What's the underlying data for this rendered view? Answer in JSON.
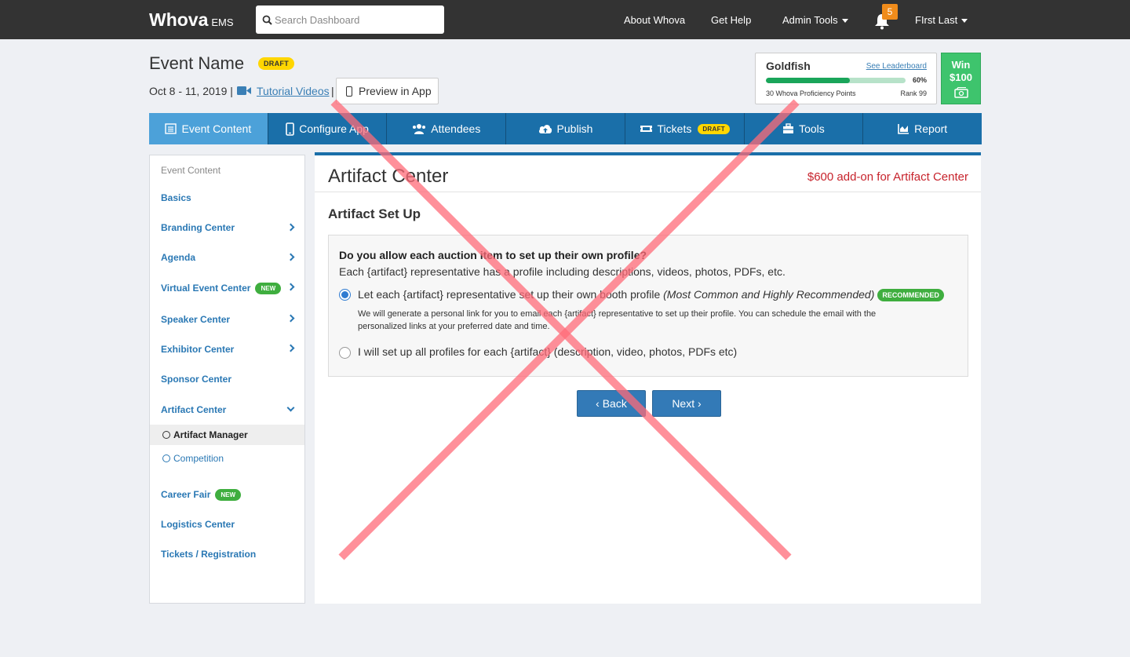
{
  "topbar": {
    "logo": "Whova",
    "logo_suffix": "EMS",
    "search_placeholder": "Search Dashboard",
    "about": "About Whova",
    "help": "Get Help",
    "admin": "Admin Tools",
    "notif_count": "5",
    "user": "FIrst Last"
  },
  "header": {
    "event_name": "Event Name",
    "draft": "DRAFT",
    "dates": "Oct 8 - 11, 2019 |",
    "tutorial": "Tutorial Videos",
    "sep": "|",
    "preview": "Preview in App"
  },
  "leaderboard": {
    "level": "Goldfish",
    "see": "See Leaderboard",
    "progress_percent": 60,
    "pct_label": "60%",
    "points": "30 Whova Proficiency Points",
    "rank": "Rank 99",
    "win_line1": "Win",
    "win_line2": "$100"
  },
  "tabs": [
    {
      "label": "Event Content",
      "icon": "list-icon"
    },
    {
      "label": "Configure App",
      "icon": "phone-icon"
    },
    {
      "label": "Attendees",
      "icon": "users-icon"
    },
    {
      "label": "Publish",
      "icon": "cloud-upload-icon"
    },
    {
      "label": "Tickets",
      "icon": "ticket-icon",
      "badge": "DRAFT"
    },
    {
      "label": "Tools",
      "icon": "toolbox-icon"
    },
    {
      "label": "Report",
      "icon": "chart-icon"
    }
  ],
  "sidebar": {
    "heading": "Event Content",
    "items": [
      {
        "label": "Basics"
      },
      {
        "label": "Branding Center"
      },
      {
        "label": "Agenda"
      },
      {
        "label": "Virtual Event Center",
        "badge": "NEW"
      },
      {
        "label": "Speaker Center"
      },
      {
        "label": "Exhibitor Center"
      },
      {
        "label": "Sponsor Center"
      },
      {
        "label": "Artifact Center"
      },
      {
        "label": "Career Fair",
        "badge": "NEW"
      },
      {
        "label": "Logistics Center"
      },
      {
        "label": "Tickets / Registration"
      }
    ],
    "sub_items": [
      {
        "label": "Artifact Manager"
      },
      {
        "label": "Competition"
      }
    ]
  },
  "main": {
    "title": "Artifact Center",
    "addon": "$600 add-on for Artifact Center",
    "setup_title": "Artifact Set Up",
    "question": "Do you allow each auction item to set up their own profile?",
    "question_desc": "Each {artifact} representative has a profile including descriptions, videos, photos, PDFs, etc.",
    "option1": "Let each {artifact} representative set up their own booth profile",
    "option1_em": "(Most Common and Highly Recommended)",
    "recommended": "RECOMMENDED",
    "option1_help": "We will generate a personal link for you to email each {artifact} representative to set up their profile. You can schedule the email with the personalized links at your preferred date and time.",
    "option2": "I will set up all profiles for each {artifact} (description, video, photos, PDFs etc)",
    "back": "Back",
    "next": "Next"
  },
  "colors": {
    "topbar": "#333333",
    "tab_bar": "#1a6fa9",
    "tab_active": "#4ca1d9",
    "link": "#2a78b4",
    "addon_red": "#c7232c",
    "button": "#337ab7",
    "overlay_x": "#ff6b78"
  }
}
